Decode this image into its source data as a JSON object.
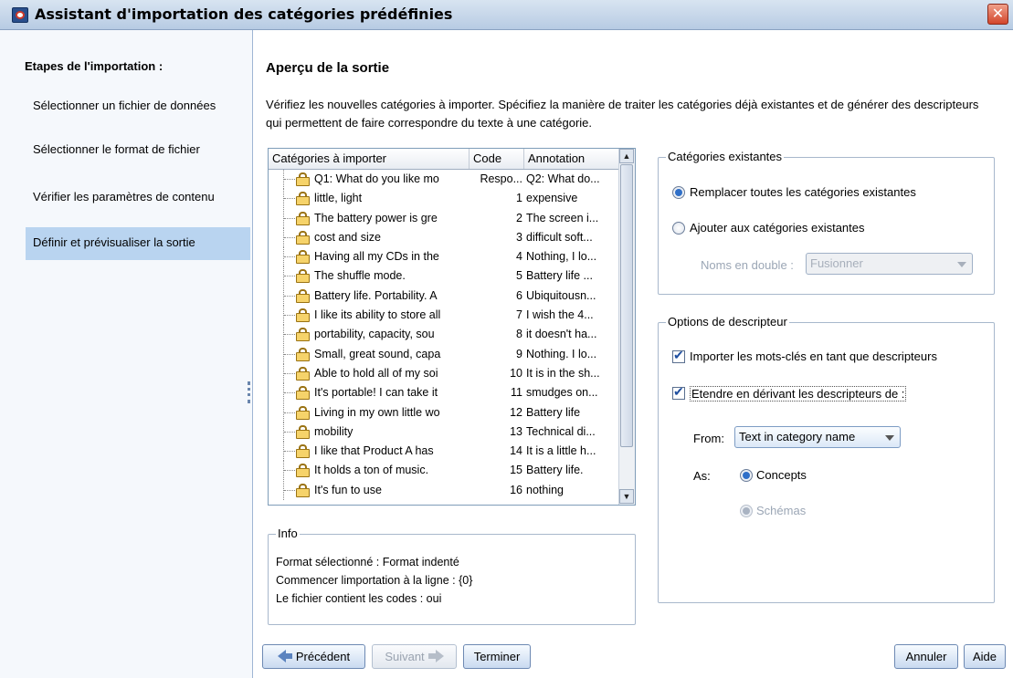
{
  "window": {
    "title": "Assistant d'importation des catégories prédéfinies",
    "close_label": "✕"
  },
  "sidebar": {
    "heading": "Etapes de l'importation :",
    "items": [
      {
        "label": "Sélectionner un fichier de données"
      },
      {
        "label": "Sélectionner le format de fichier"
      },
      {
        "label": "Vérifier les paramètres de contenu"
      },
      {
        "label": "Définir et prévisualiser la sortie"
      }
    ]
  },
  "main": {
    "title": "Aperçu de la sortie",
    "description": "Vérifiez les nouvelles catégories à importer. Spécifiez la manière de traiter les catégories déjà existantes et de générer des descripteurs qui permettent de faire correspondre du texte à une catégorie."
  },
  "table": {
    "columns": [
      "Catégories à importer",
      "Code",
      "Annotation"
    ],
    "rows": [
      {
        "name": "Q1: What do you like mo",
        "code": "Respo...",
        "annotation": "Q2: What do..."
      },
      {
        "name": "little, light",
        "code": "1",
        "annotation": "expensive"
      },
      {
        "name": "The battery power is gre",
        "code": "2",
        "annotation": "The screen i..."
      },
      {
        "name": "cost and size",
        "code": "3",
        "annotation": "difficult soft..."
      },
      {
        "name": "Having all my CDs in the",
        "code": "4",
        "annotation": "Nothing, I lo..."
      },
      {
        "name": "The shuffle mode.",
        "code": "5",
        "annotation": "Battery life ..."
      },
      {
        "name": "Battery life. Portability. A",
        "code": "6",
        "annotation": "Ubiquitousn..."
      },
      {
        "name": "I like its ability to store all",
        "code": "7",
        "annotation": "I wish the 4..."
      },
      {
        "name": "portability, capacity, sou",
        "code": "8",
        "annotation": "it doesn't ha..."
      },
      {
        "name": "Small, great sound, capa",
        "code": "9",
        "annotation": "Nothing. I lo..."
      },
      {
        "name": "Able to hold all of my soi",
        "code": "10",
        "annotation": "It is in the sh..."
      },
      {
        "name": "It's portable! I can take it",
        "code": "11",
        "annotation": "smudges on..."
      },
      {
        "name": "Living in my own little wo",
        "code": "12",
        "annotation": "Battery life"
      },
      {
        "name": "mobility",
        "code": "13",
        "annotation": "Technical di..."
      },
      {
        "name": "I like that Product A has",
        "code": "14",
        "annotation": "It is a little h..."
      },
      {
        "name": "It holds a ton of music.",
        "code": "15",
        "annotation": "Battery life."
      },
      {
        "name": "It's fun to use",
        "code": "16",
        "annotation": "nothing"
      }
    ]
  },
  "existing": {
    "title": "Catégories existantes",
    "replace_label": "Remplacer toutes les catégories existantes",
    "replace_selected": true,
    "add_label": "Ajouter aux catégories existantes",
    "duplicates_label": "Noms en double :",
    "duplicates_value": "Fusionner"
  },
  "descriptor": {
    "title": "Options de descripteur",
    "import_keywords_label": "Importer les mots-clés en tant que descripteurs",
    "import_keywords_checked": true,
    "extend_label": "Etendre en dérivant les descripteurs de :",
    "extend_checked": true,
    "from_label": "From:",
    "from_value": "Text in category name",
    "as_label": "As:",
    "as_concepts_label": "Concepts",
    "as_schemas_label": "Schémas"
  },
  "info": {
    "title": "Info",
    "lines": [
      "Format sélectionné : Format indenté",
      "Commencer limportation à la ligne : {0}",
      "Le fichier contient les codes : oui"
    ]
  },
  "buttons": {
    "previous": "Précédent",
    "next": "Suivant",
    "finish": "Terminer",
    "cancel": "Annuler",
    "help": "Aide"
  }
}
